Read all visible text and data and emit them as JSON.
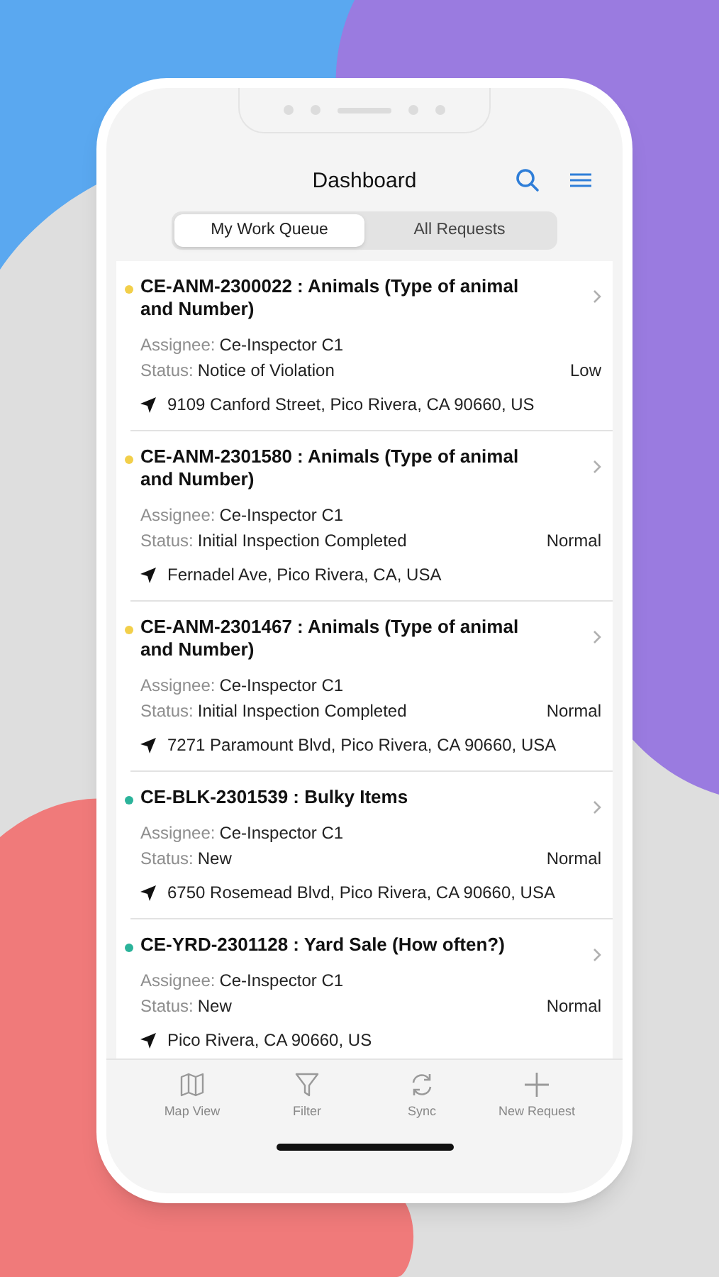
{
  "header": {
    "title": "Dashboard"
  },
  "tabs": [
    {
      "label": "My Work Queue",
      "selected": true
    },
    {
      "label": "All Requests",
      "selected": false
    }
  ],
  "requests": [
    {
      "title": "CE-ANM-2300022 : Animals (Type of animal and Number)",
      "color": "#f2cf4a",
      "assignee_label": "Assignee:",
      "assignee": "Ce-Inspector C1",
      "status_label": "Status:",
      "status": "Notice of Violation",
      "priority": "Low",
      "address": "9109 Canford Street, Pico Rivera, CA 90660, US"
    },
    {
      "title": "CE-ANM-2301580 : Animals (Type of animal and Number)",
      "color": "#f2cf4a",
      "assignee_label": "Assignee:",
      "assignee": "Ce-Inspector C1",
      "status_label": "Status:",
      "status": "Initial Inspection Completed",
      "priority": "Normal",
      "address": "Fernadel Ave, Pico Rivera, CA, USA"
    },
    {
      "title": "CE-ANM-2301467 : Animals (Type of animal and Number)",
      "color": "#f2cf4a",
      "assignee_label": "Assignee:",
      "assignee": "Ce-Inspector C1",
      "status_label": "Status:",
      "status": "Initial Inspection Completed",
      "priority": "Normal",
      "address": "7271 Paramount Blvd, Pico Rivera, CA 90660, USA"
    },
    {
      "title": "CE-BLK-2301539 : Bulky Items",
      "color": "#2bb39a",
      "assignee_label": "Assignee:",
      "assignee": "Ce-Inspector C1",
      "status_label": "Status:",
      "status": "New",
      "priority": "Normal",
      "address": "6750 Rosemead Blvd, Pico Rivera, CA 90660, USA"
    },
    {
      "title": "CE-YRD-2301128 : Yard Sale (How often?)",
      "color": "#2bb39a",
      "assignee_label": "Assignee:",
      "assignee": "Ce-Inspector C1",
      "status_label": "Status:",
      "status": "New",
      "priority": "Normal",
      "address": "Pico Rivera, CA 90660, US"
    }
  ],
  "toolbar": [
    {
      "kind": "map",
      "label": "Map View"
    },
    {
      "kind": "filter",
      "label": "Filter"
    },
    {
      "kind": "sync",
      "label": "Sync"
    },
    {
      "kind": "add",
      "label": "New Request"
    }
  ]
}
